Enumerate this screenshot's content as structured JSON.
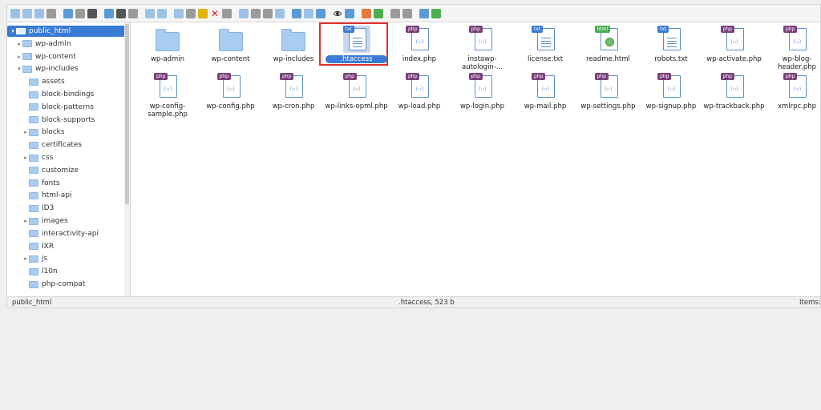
{
  "toolbar": {
    "icons": [
      "back-icon",
      "forward-icon",
      "up-icon",
      "reload-icon",
      "home-icon",
      "open-icon",
      "save-icon",
      "copy-icon",
      "paste-icon",
      "select-icon",
      "undo-icon",
      "redo-icon",
      "duplicate-icon",
      "cut-icon",
      "paste-icon",
      "delete-icon",
      "rename-icon",
      "edit-icon",
      "new-file-icon",
      "new-folder-icon",
      "archive-icon",
      "extract-icon",
      "info-icon",
      "view-icon",
      "grid-view-icon",
      "list-view-icon",
      "sort-icon",
      "help-icon",
      "fullscreen-icon"
    ]
  },
  "tree": {
    "items": [
      {
        "label": "public_html",
        "level": 0,
        "expanded": true,
        "selected": true,
        "arrow": "▾"
      },
      {
        "label": "wp-admin",
        "level": 1,
        "arrow": "▸"
      },
      {
        "label": "wp-content",
        "level": 1,
        "arrow": "▸"
      },
      {
        "label": "wp-includes",
        "level": 1,
        "arrow": "▾"
      },
      {
        "label": "assets",
        "level": 2,
        "arrow": ""
      },
      {
        "label": "block-bindings",
        "level": 2,
        "arrow": ""
      },
      {
        "label": "block-patterns",
        "level": 2,
        "arrow": ""
      },
      {
        "label": "block-supports",
        "level": 2,
        "arrow": ""
      },
      {
        "label": "blocks",
        "level": 2,
        "arrow": "▸"
      },
      {
        "label": "certificates",
        "level": 2,
        "arrow": ""
      },
      {
        "label": "css",
        "level": 2,
        "arrow": "▸"
      },
      {
        "label": "customize",
        "level": 2,
        "arrow": ""
      },
      {
        "label": "fonts",
        "level": 2,
        "arrow": ""
      },
      {
        "label": "html-api",
        "level": 2,
        "arrow": ""
      },
      {
        "label": "ID3",
        "level": 2,
        "arrow": ""
      },
      {
        "label": "images",
        "level": 2,
        "arrow": "▸"
      },
      {
        "label": "interactivity-api",
        "level": 2,
        "arrow": ""
      },
      {
        "label": "IXR",
        "level": 2,
        "arrow": ""
      },
      {
        "label": "js",
        "level": 2,
        "arrow": "▸"
      },
      {
        "label": "l10n",
        "level": 2,
        "arrow": ""
      },
      {
        "label": "php-compat",
        "level": 2,
        "arrow": ""
      }
    ]
  },
  "files": [
    {
      "name": "wp-admin",
      "type": "folder"
    },
    {
      "name": "wp-content",
      "type": "folder"
    },
    {
      "name": "wp-includes",
      "type": "folder"
    },
    {
      "name": ".htaccess",
      "type": "txt",
      "badge": "txt",
      "selected": true
    },
    {
      "name": "index.php",
      "type": "php",
      "badge": "php"
    },
    {
      "name": "instawp-autologin-...",
      "type": "php",
      "badge": "php"
    },
    {
      "name": "license.txt",
      "type": "txt",
      "badge": "txt"
    },
    {
      "name": "readme.html",
      "type": "html",
      "badge": "html"
    },
    {
      "name": "robots.txt",
      "type": "txt",
      "badge": "txt"
    },
    {
      "name": "wp-activate.php",
      "type": "php",
      "badge": "php"
    },
    {
      "name": "wp-blog-header.php",
      "type": "php",
      "badge": "php"
    },
    {
      "name": "wp-config-sample.php",
      "type": "php",
      "badge": "php"
    },
    {
      "name": "wp-config.php",
      "type": "php",
      "badge": "php"
    },
    {
      "name": "wp-cron.php",
      "type": "php",
      "badge": "php"
    },
    {
      "name": "wp-links-opml.php",
      "type": "php",
      "badge": "php"
    },
    {
      "name": "wp-load.php",
      "type": "php",
      "badge": "php"
    },
    {
      "name": "wp-login.php",
      "type": "php",
      "badge": "php"
    },
    {
      "name": "wp-mail.php",
      "type": "php",
      "badge": "php"
    },
    {
      "name": "wp-settings.php",
      "type": "php",
      "badge": "php"
    },
    {
      "name": "wp-signup.php",
      "type": "php",
      "badge": "php"
    },
    {
      "name": "wp-trackback.php",
      "type": "php",
      "badge": "php"
    },
    {
      "name": "xmlrpc.php",
      "type": "php",
      "badge": "php"
    }
  ],
  "status": {
    "path": "public_html",
    "selection": ".htaccess, 523 b",
    "items": "Items:"
  },
  "colors": {
    "accent": "#3a7bd5",
    "highlight_border": "#e03030",
    "php_badge": "#7a3f7a",
    "folder": "#a9cdf0"
  }
}
